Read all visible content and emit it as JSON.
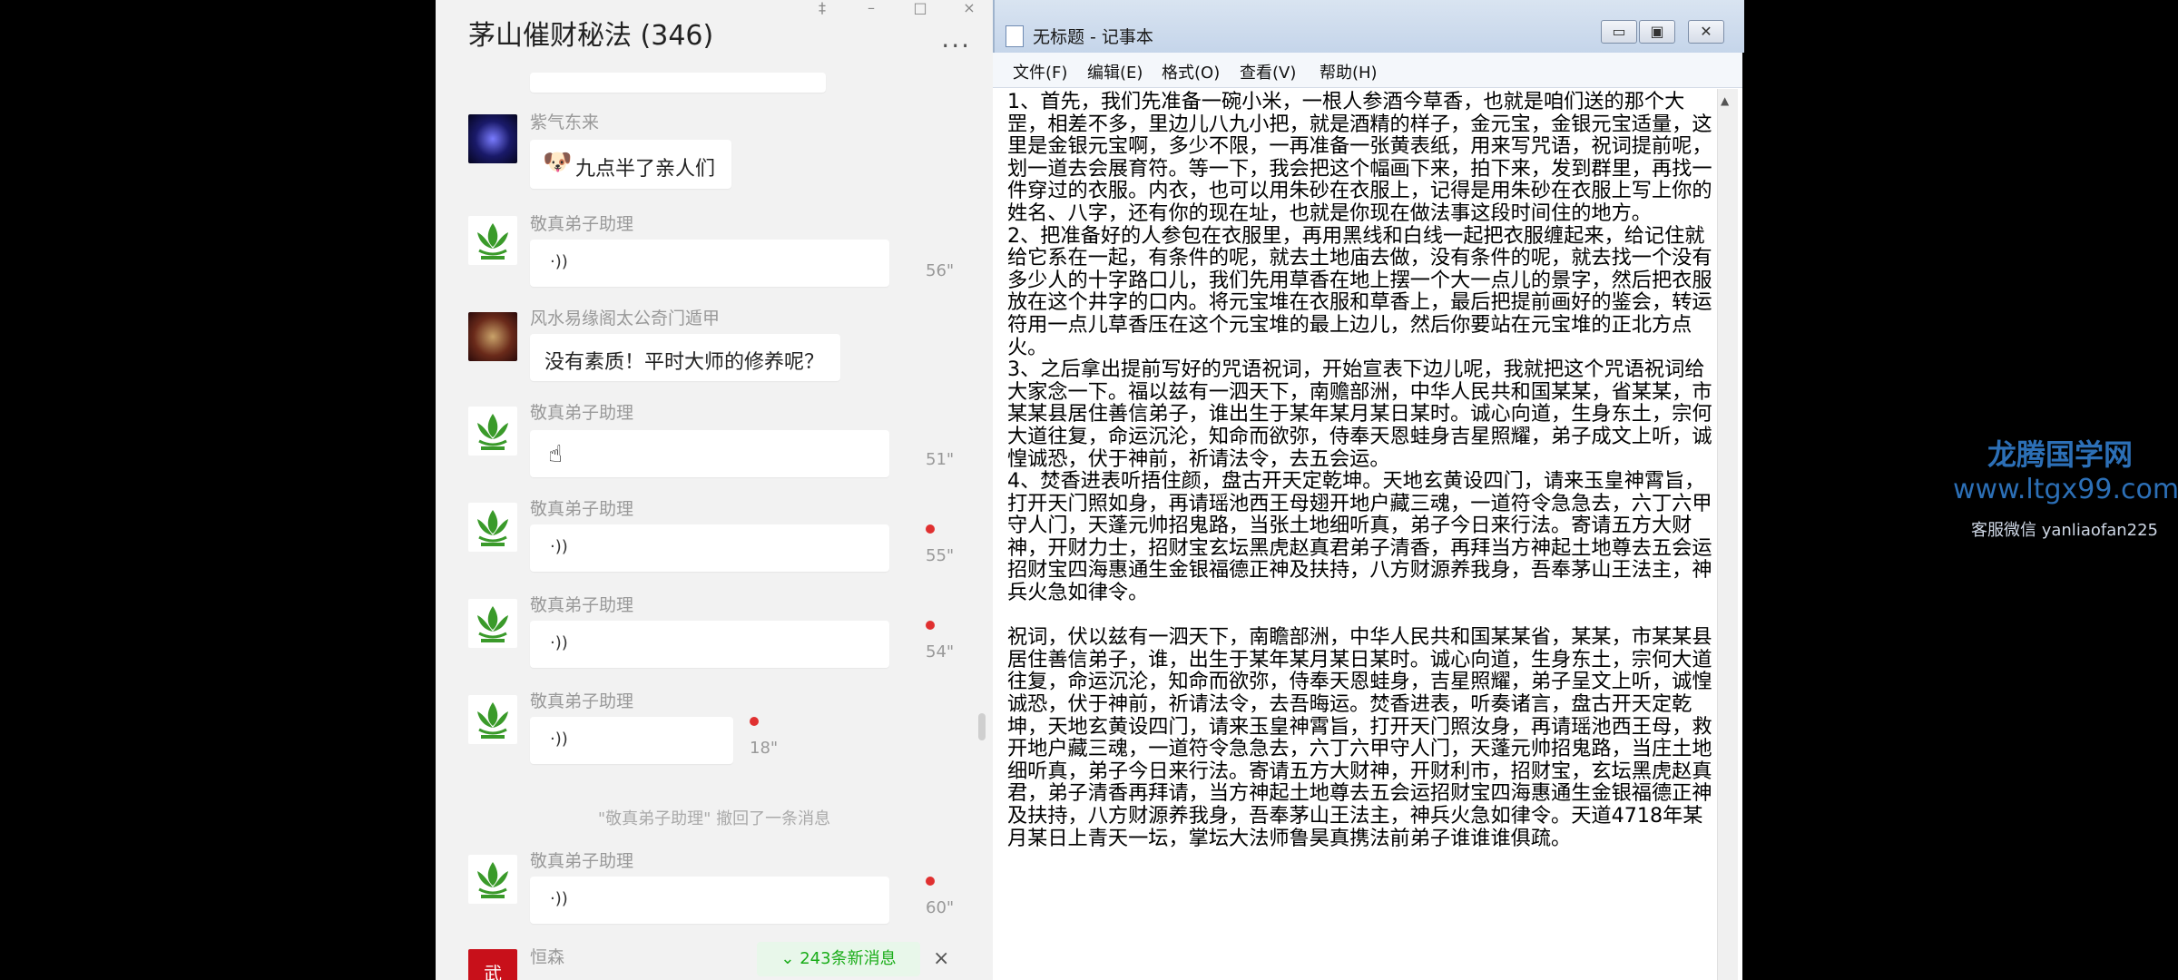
{
  "chat": {
    "title": "茅山催财秘法 (346)",
    "window_controls": [
      "‡",
      "–",
      "□",
      "×"
    ],
    "more": "···",
    "messages": [
      {
        "sender": "紫气东来",
        "text": "九点半了亲人们",
        "emoji": "🐶"
      },
      {
        "sender": "敬真弟子助理",
        "voice": "56\""
      },
      {
        "sender": "风水易缘阁太公奇门遁甲",
        "text": "没有素质！平时大师的修养呢？"
      },
      {
        "sender": "敬真弟子助理",
        "voice": "51\""
      },
      {
        "sender": "敬真弟子助理",
        "voice": "55\""
      },
      {
        "sender": "敬真弟子助理",
        "voice": "54\""
      },
      {
        "sender": "敬真弟子助理",
        "voice": "18\""
      },
      {
        "sender": "敬真弟子助理",
        "voice": "60\""
      },
      {
        "sender": "恒森",
        "avatar_text": "武"
      }
    ],
    "recall_notice": "\"敬真弟子助理\" 撤回了一条消息",
    "new_messages": "243条新消息",
    "new_messages_close": "×",
    "voice_icon": "·))"
  },
  "notepad": {
    "title": "无标题 - 记事本",
    "controls": [
      "▭",
      "▣",
      "✕"
    ],
    "menu": [
      "文件(F)",
      "编辑(E)",
      "格式(O)",
      "查看(V)",
      "帮助(H)"
    ],
    "content": "1、首先，我们先准备一碗小米，一根人参酒今草香，也就是咱们送的那个大罡，相差不多，里边儿八九小把，就是酒精的样子，金元宝，金银元宝适量，这里是金银元宝啊，多少不限，一再准备一张黄表纸，用来写咒语，祝词提前呢，划一道去会展育符。等一下，我会把这个幅画下来，拍下来，发到群里，再找一件穿过的衣服。内衣，也可以用朱砂在衣服上，记得是用朱砂在衣服上写上你的姓名、八字，还有你的现在址，也就是你现在做法事这段时间住的地方。\n2、把准备好的人参包在衣服里，再用黑线和白线一起把衣服缠起来，给记住就给它系在一起，有条件的呢，就去土地庙去做，没有条件的呢，就去找一个没有多少人的十字路口儿，我们先用草香在地上摆一个大一点儿的景字，然后把衣服放在这个井字的口内。将元宝堆在衣服和草香上，最后把提前画好的鉴会，转运符用一点儿草香压在这个元宝堆的最上边儿，然后你要站在元宝堆的正北方点火。\n3、之后拿出提前写好的咒语祝词，开始宣表下边儿呢，我就把这个咒语祝词给大家念一下。福以兹有一泗天下，南赡部洲，中华人民共和国某某，省某某，市某某县居住善信弟子，谁出生于某年某月某日某时。诚心向道，生身东土，宗何大道往复，命运沉沦，知命而欲弥，侍奉天恩蛙身吉星照耀，弟子成文上听，诚惶诚恐，伏于神前，祈请法令，去五会运。\n4、焚香进表听捂住颜，盘古开天定乾坤。天地玄黄设四门，请来玉皇神霄旨，打开天门照如身，再请瑶池西王母翅开地户藏三魂，一道符令急急去，六丁六甲守人门，天蓬元帅招鬼路，当张土地细听真，弟子今日来行法。寄请五方大财神，开财力士，招财宝玄坛黑虎赵真君弟子清香，再拜当方神起土地尊去五会运招财宝四海惠通生金银福德正神及扶持，八方财源养我身，吾奉茅山王法主，神兵火急如律令。\n\n祝词，伏以兹有一泗天下，南瞻部洲，中华人民共和国某某省，某某，市某某县居住善信弟子，谁，出生于某年某月某日某时。诚心向道，生身东土，宗何大道往复，命运沉沦，知命而欲弥，侍奉天恩蛙身，吉星照耀，弟子呈文上听，诚惶诚恐，伏于神前，祈请法令，去吾晦运。焚香进表，听奏诸言，盘古开天定乾坤，天地玄黄设四门，请来玉皇神霄旨，打开天门照汝身，再请瑶池西王母，救开地户藏三魂，一道符令急急去，六丁六甲守人门，天蓬元帅招鬼路，当庄土地细听真，弟子今日来行法。寄请五方大财神，开财利市，招财宝，玄坛黑虎赵真君，弟子清香再拜请，当方神起土地尊去五会运招财宝四海惠通生金银福德正神及扶持，八方财源养我身，吾奉茅山王法主，神兵火急如律令。天道4718年某月某日上青天一坛，掌坛大法师鲁昊真携法前弟子谁谁谁俱疏。"
  },
  "watermark": {
    "name": "龙腾国学网",
    "url": "www.ltgx99.com",
    "contact": "客服微信 yanliaofan225"
  },
  "colors": {
    "wechat_green": "#1aad19",
    "red_dot": "#e03030",
    "watermark_blue": "#2c6fb6"
  }
}
